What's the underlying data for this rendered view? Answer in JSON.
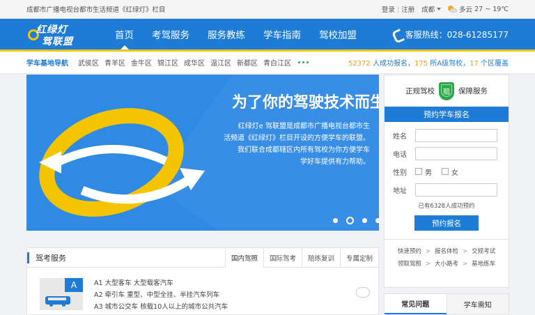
{
  "topbar": {
    "site_title": "成都市广播电视台都市生活频道《红绿灯》栏目",
    "login": "登录",
    "divider": "|",
    "register": "注册",
    "city": "成都",
    "weather": "多云",
    "temperature": "27 ~ 19℃"
  },
  "nav": {
    "logo_line1": "红绿灯",
    "logo_line2": "驾联盟",
    "items": [
      {
        "label": "首页"
      },
      {
        "label": "考驾服务"
      },
      {
        "label": "服务教练"
      },
      {
        "label": "学车指南"
      },
      {
        "label": "驾校加盟"
      }
    ],
    "hotline": "客服热线：028-61285177"
  },
  "districts": {
    "tag": "学车基地导航",
    "items": [
      "武侯区",
      "青羊区",
      "金牛区",
      "锦江区",
      "成华区",
      "温江区",
      "新都区",
      "青白江区"
    ]
  },
  "stats": {
    "signups": "52372",
    "signups_label": " 人成功报名，",
    "schools": "175",
    "schools_label": " 所A级驾校，",
    "regions": "17",
    "regions_label": " 个区覆盖"
  },
  "banner": {
    "headline": "为了你的驾驶技术而生",
    "desc_1": "红绿灯e 驾联盟是成都市广播电视台都市生",
    "desc_2": "活频道《红绿灯》栏目开设的方便学车的联盟。",
    "desc_3": "我们联合成都辖区内所有驾校为你方便学车",
    "desc_4": "学好车提供有力帮助。",
    "slide_count": 5,
    "active_slide": 2
  },
  "panel": {
    "brand_left": "正规驾校",
    "brand_badge": "赔",
    "brand_right": "保障服务",
    "title": "预约学车报名",
    "name_label": "姓名",
    "phone_label": "电话",
    "gender_label": "性别",
    "male": "男",
    "female": "女",
    "address_label": "地址",
    "count_text": "已有6328人成功预约",
    "submit": "预约报名",
    "links_row1": [
      "快速预约",
      "报名体检",
      "交规考试"
    ],
    "links_row2": [
      "领取驾照",
      "大小路考",
      "基地练车"
    ],
    "arrow": ">"
  },
  "service": {
    "title": "驾考服务",
    "tabs": [
      "国内驾照",
      "国际驾考",
      "陪练复训",
      "专属定制"
    ],
    "card_class": "A",
    "classes": [
      "A1 大型客车  大型载客汽车",
      "A2 牵引车  重型、中型全挂、半挂汽车列车",
      "A3 城市公交车  核载10人以上的城市公共汽车"
    ]
  },
  "faq": {
    "tabs": [
      "常见问题",
      "学车需知"
    ]
  },
  "colors": {
    "primary": "#1e7bd6",
    "accent": "#f7c600",
    "green": "#2aa84a",
    "stat_orange": "#f29d12"
  }
}
